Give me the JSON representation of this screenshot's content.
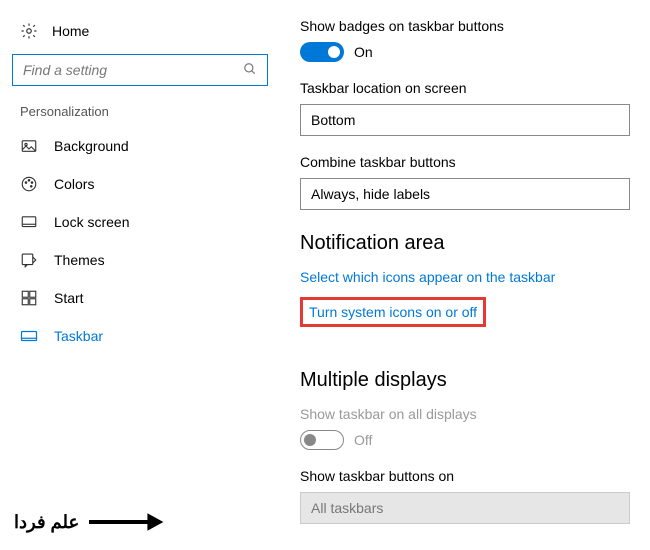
{
  "sidebar": {
    "home_label": "Home",
    "search_placeholder": "Find a setting",
    "section_label": "Personalization",
    "items": [
      {
        "label": "Background",
        "icon": "image-icon"
      },
      {
        "label": "Colors",
        "icon": "palette-icon"
      },
      {
        "label": "Lock screen",
        "icon": "lockscreen-icon"
      },
      {
        "label": "Themes",
        "icon": "themes-icon"
      },
      {
        "label": "Start",
        "icon": "start-icon"
      },
      {
        "label": "Taskbar",
        "icon": "taskbar-icon"
      }
    ]
  },
  "main": {
    "badges_label": "Show badges on taskbar buttons",
    "badges_value": "On",
    "location_label": "Taskbar location on screen",
    "location_value": "Bottom",
    "combine_label": "Combine taskbar buttons",
    "combine_value": "Always, hide labels",
    "notification_title": "Notification area",
    "link_icons": "Select which icons appear on the taskbar",
    "link_system_icons": "Turn system icons on or off",
    "multiple_title": "Multiple displays",
    "show_all_label": "Show taskbar on all displays",
    "show_all_value": "Off",
    "show_buttons_label": "Show taskbar buttons on",
    "show_buttons_value": "All taskbars"
  },
  "watermark": {
    "text": "علم فردا"
  }
}
